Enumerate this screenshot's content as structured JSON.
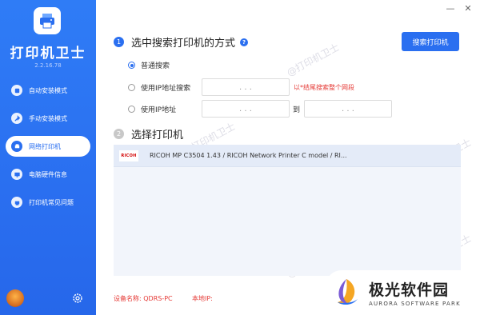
{
  "app": {
    "title": "打印机卫士",
    "version": "2.2.16.78",
    "accent": "#2a6ff0"
  },
  "window": {
    "minimize_label": "—",
    "close_label": "✕"
  },
  "sidebar": {
    "items": [
      {
        "label": "自动安装模式",
        "icon": "auto-install-icon",
        "active": false
      },
      {
        "label": "手动安装模式",
        "icon": "wrench-icon",
        "active": false
      },
      {
        "label": "网络打印机",
        "icon": "network-printer-icon",
        "active": true
      },
      {
        "label": "电脑硬件信息",
        "icon": "monitor-icon",
        "active": false
      },
      {
        "label": "打印机常见问题",
        "icon": "printer-faq-icon",
        "active": false
      }
    ]
  },
  "search_section": {
    "step": "1",
    "title": "选中搜索打印机的方式",
    "help": "?",
    "search_button": "搜索打印机",
    "options": [
      {
        "label": "普通搜索",
        "checked": true
      },
      {
        "label": "使用IP地址搜索",
        "checked": false
      },
      {
        "label": "使用IP地址",
        "checked": false
      }
    ],
    "ip_dots": ".   .   .",
    "ip_hint": "以*结尾搜索整个网段",
    "range_to": "到"
  },
  "printer_section": {
    "step": "2",
    "title": "选择打印机",
    "printers": [
      {
        "logo": "RICOH",
        "name": "RICOH MP C3504 1.43 / RICOH Network Printer C model / RI..."
      }
    ]
  },
  "footer": {
    "device_label": "设备名称: QDRS-PC",
    "local_ip_label": "本地IP:"
  },
  "watermark": "@打印机卫士",
  "brand": {
    "cn": "极光软件园",
    "en": "AURORA SOFTWARE PARK"
  }
}
